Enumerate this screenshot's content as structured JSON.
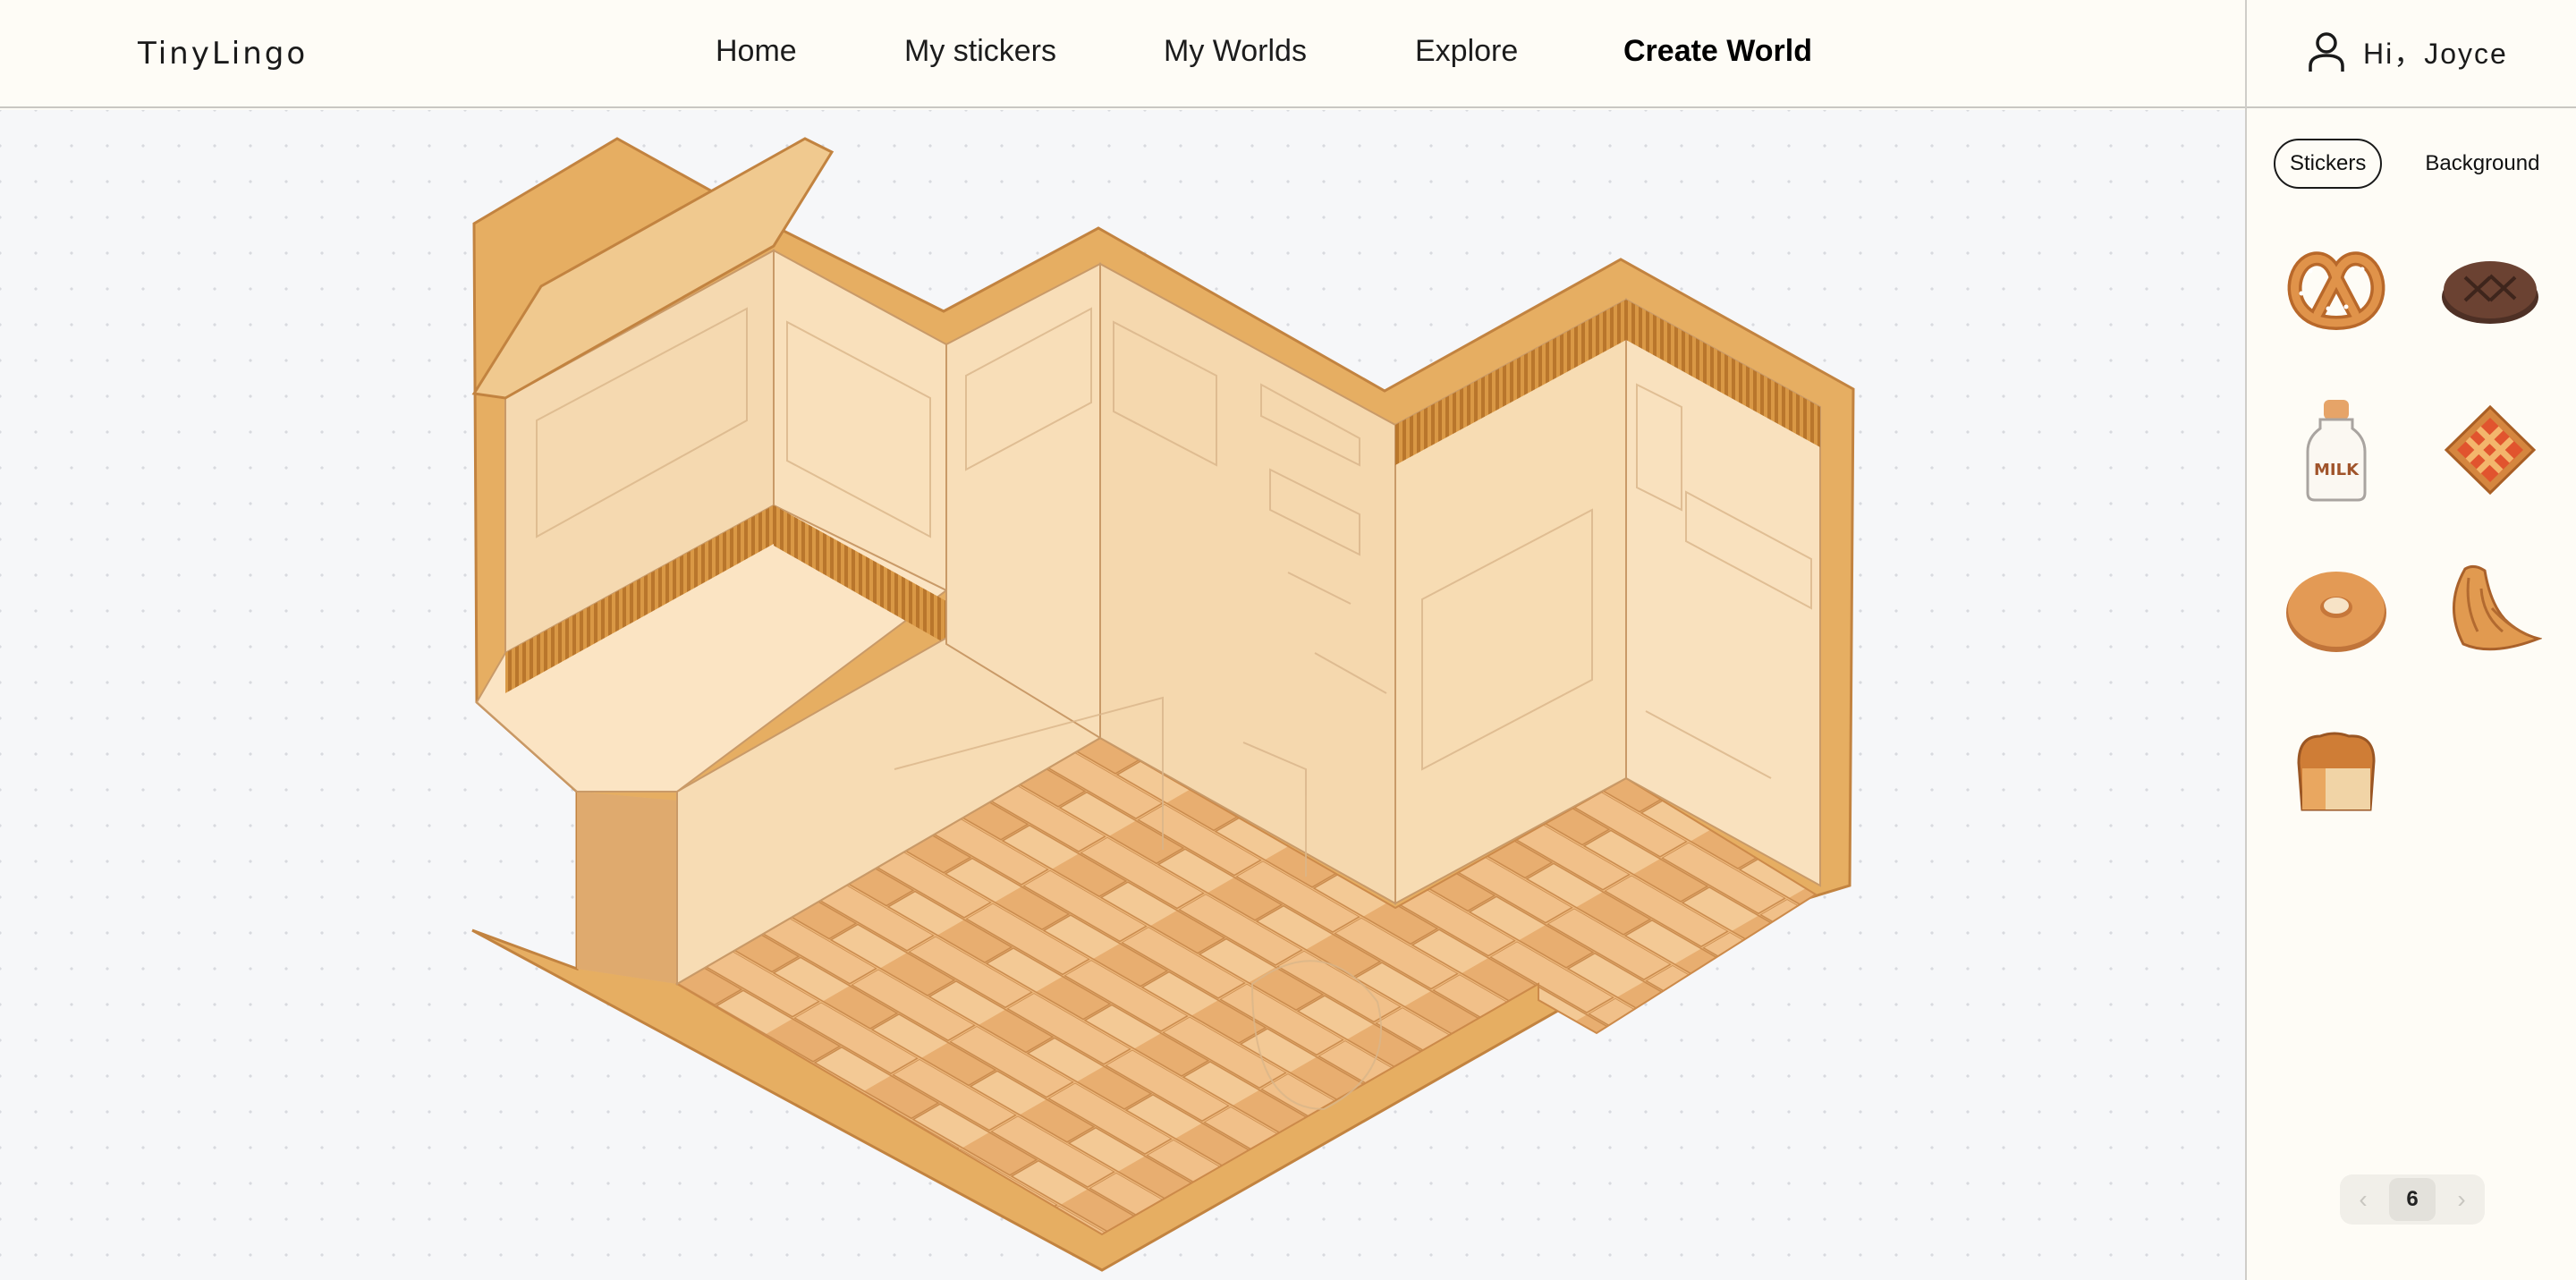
{
  "app": {
    "logo": "TinyLingo"
  },
  "nav": {
    "items": [
      {
        "label": "Home"
      },
      {
        "label": "My stickers"
      },
      {
        "label": "My Worlds"
      },
      {
        "label": "Explore"
      },
      {
        "label": "Create World",
        "active": true
      }
    ]
  },
  "user": {
    "greeting": "Hi，Joyce",
    "icon": "user-icon"
  },
  "sidebar": {
    "tabs": [
      {
        "label": "Stickers",
        "active": true
      },
      {
        "label": "Background",
        "active": false
      }
    ],
    "stickers": [
      {
        "name": "pretzel"
      },
      {
        "name": "dark-bread-loaf"
      },
      {
        "name": "milk-bottle",
        "text": "MILK"
      },
      {
        "name": "lattice-pie"
      },
      {
        "name": "bagel"
      },
      {
        "name": "croissant"
      },
      {
        "name": "bread-loaf"
      }
    ],
    "pagination": {
      "prev": "‹",
      "page": "6",
      "next": "›"
    }
  },
  "colors": {
    "wall": "#f7dfb9",
    "floor": "#ebb77c",
    "rim": "#e8b46c",
    "canvas": "#f6f7f9"
  }
}
